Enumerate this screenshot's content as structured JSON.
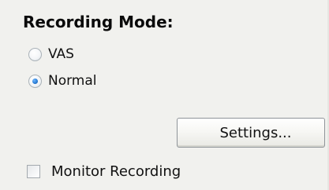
{
  "recording_mode": {
    "title": "Recording Mode:",
    "options": [
      {
        "label": "VAS",
        "selected": false
      },
      {
        "label": "Normal",
        "selected": true
      }
    ]
  },
  "settings_button": {
    "label": "Settings..."
  },
  "monitor_recording": {
    "label": "Monitor Recording",
    "checked": false
  },
  "colors": {
    "background": "#f1f1ee",
    "radio_accent": "#2c7fd6",
    "button_border": "#8f9499"
  }
}
